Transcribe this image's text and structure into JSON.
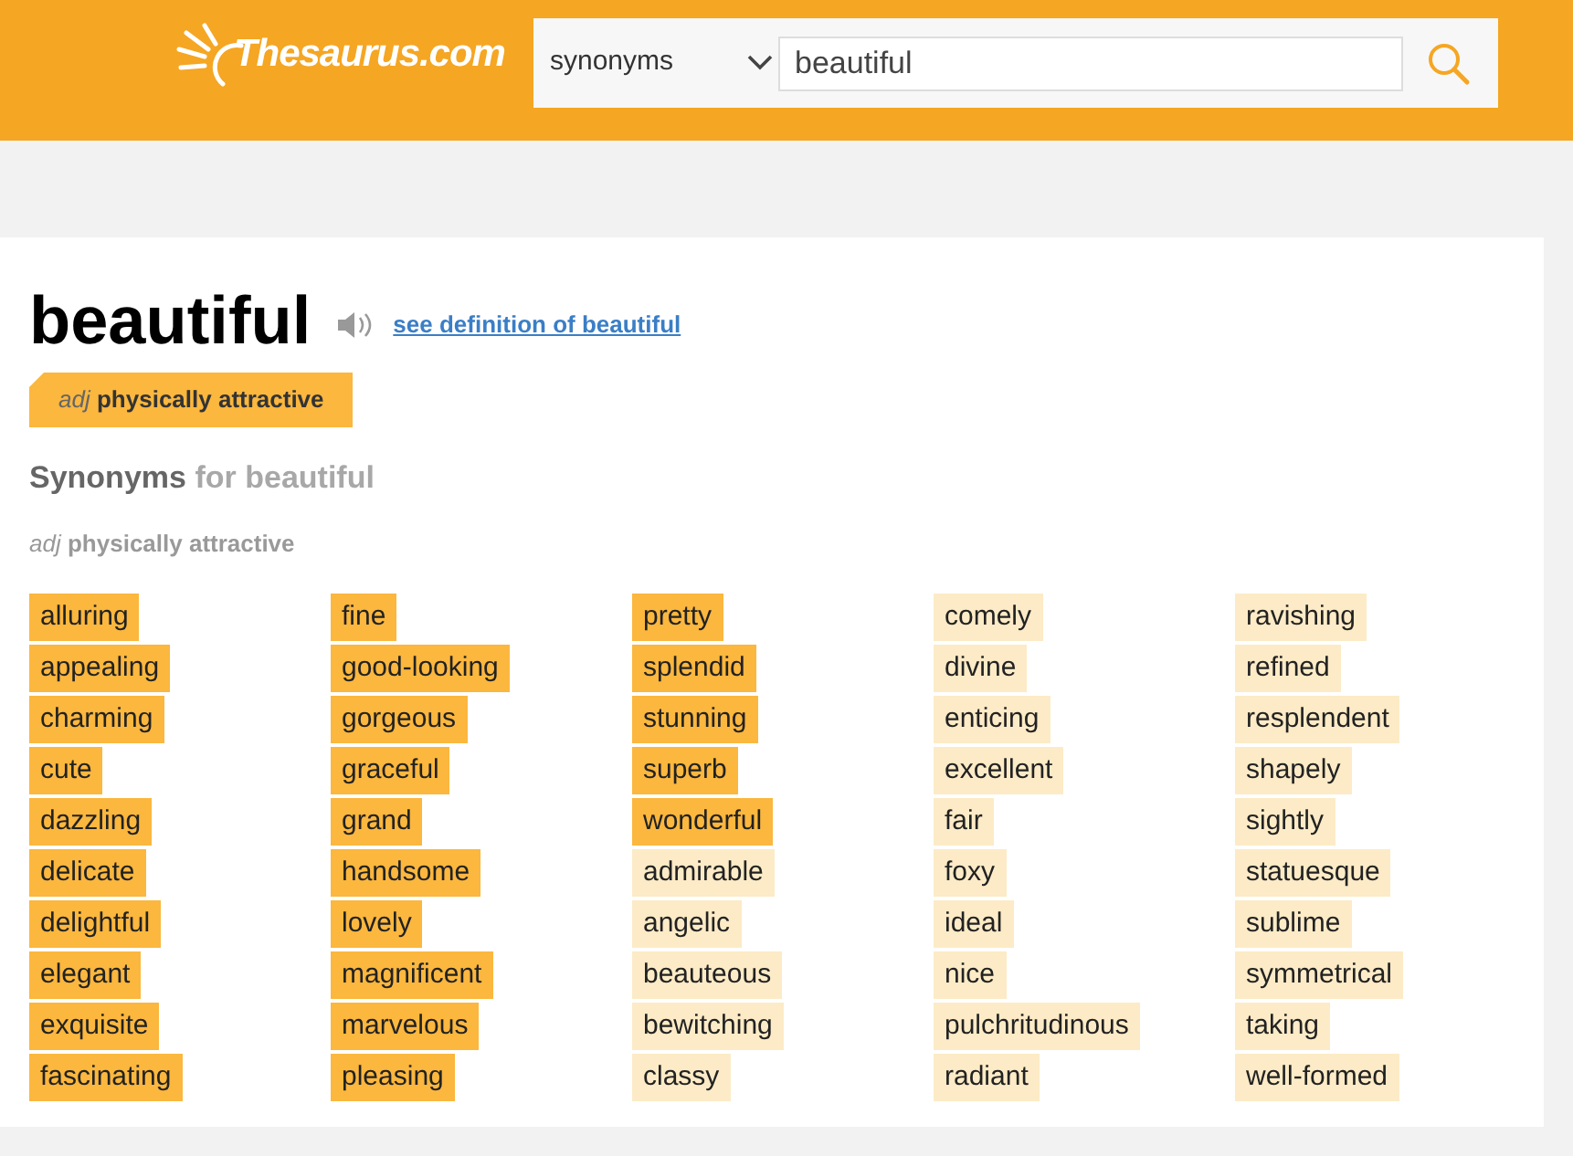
{
  "header": {
    "logo": "Thesaurus.com",
    "search_type": "synonyms",
    "search_value": "beautiful"
  },
  "entry": {
    "word": "beautiful",
    "definition_link": "see definition of beautiful"
  },
  "sense_tabs": [
    {
      "pos": "adj",
      "label": "physically attractive",
      "selected": true
    }
  ],
  "synonyms_heading": {
    "title": "Synonyms",
    "subtitle": "for beautiful"
  },
  "sense": {
    "pos": "adj",
    "label": "physically attractive"
  },
  "synonyms": [
    {
      "word": "alluring",
      "kind": "strong"
    },
    {
      "word": "appealing",
      "kind": "strong"
    },
    {
      "word": "charming",
      "kind": "strong"
    },
    {
      "word": "cute",
      "kind": "strong"
    },
    {
      "word": "dazzling",
      "kind": "strong"
    },
    {
      "word": "delicate",
      "kind": "strong"
    },
    {
      "word": "delightful",
      "kind": "strong"
    },
    {
      "word": "elegant",
      "kind": "strong"
    },
    {
      "word": "exquisite",
      "kind": "strong"
    },
    {
      "word": "fascinating",
      "kind": "strong"
    },
    {
      "word": "fine",
      "kind": "strong"
    },
    {
      "word": "good-looking",
      "kind": "strong"
    },
    {
      "word": "gorgeous",
      "kind": "strong"
    },
    {
      "word": "graceful",
      "kind": "strong"
    },
    {
      "word": "grand",
      "kind": "strong"
    },
    {
      "word": "handsome",
      "kind": "strong"
    },
    {
      "word": "lovely",
      "kind": "strong"
    },
    {
      "word": "magnificent",
      "kind": "strong"
    },
    {
      "word": "marvelous",
      "kind": "strong"
    },
    {
      "word": "pleasing",
      "kind": "strong"
    },
    {
      "word": "pretty",
      "kind": "strong"
    },
    {
      "word": "splendid",
      "kind": "strong"
    },
    {
      "word": "stunning",
      "kind": "strong"
    },
    {
      "word": "superb",
      "kind": "strong"
    },
    {
      "word": "wonderful",
      "kind": "strong"
    },
    {
      "word": "admirable",
      "kind": "weak"
    },
    {
      "word": "angelic",
      "kind": "weak"
    },
    {
      "word": "beauteous",
      "kind": "weak"
    },
    {
      "word": "bewitching",
      "kind": "weak"
    },
    {
      "word": "classy",
      "kind": "weak"
    },
    {
      "word": "comely",
      "kind": "weak"
    },
    {
      "word": "divine",
      "kind": "weak"
    },
    {
      "word": "enticing",
      "kind": "weak"
    },
    {
      "word": "excellent",
      "kind": "weak"
    },
    {
      "word": "fair",
      "kind": "weak"
    },
    {
      "word": "foxy",
      "kind": "weak"
    },
    {
      "word": "ideal",
      "kind": "weak"
    },
    {
      "word": "nice",
      "kind": "weak"
    },
    {
      "word": "pulchritudinous",
      "kind": "weak"
    },
    {
      "word": "radiant",
      "kind": "weak"
    },
    {
      "word": "ravishing",
      "kind": "weak"
    },
    {
      "word": "refined",
      "kind": "weak"
    },
    {
      "word": "resplendent",
      "kind": "weak"
    },
    {
      "word": "shapely",
      "kind": "weak"
    },
    {
      "word": "sightly",
      "kind": "weak"
    },
    {
      "word": "statuesque",
      "kind": "weak"
    },
    {
      "word": "sublime",
      "kind": "weak"
    },
    {
      "word": "symmetrical",
      "kind": "weak"
    },
    {
      "word": "taking",
      "kind": "weak"
    },
    {
      "word": "well-formed",
      "kind": "weak"
    }
  ]
}
